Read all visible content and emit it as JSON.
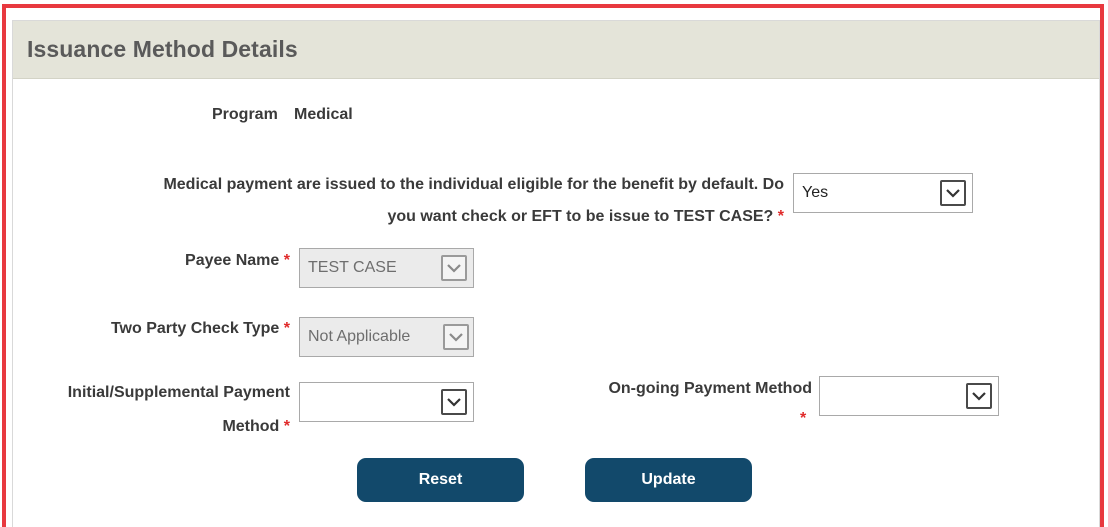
{
  "panel": {
    "title": "Issuance Method Details"
  },
  "program": {
    "label": "Program",
    "value": "Medical"
  },
  "question": {
    "line1": "Medical payment are issued to the individual eligible for the benefit by default. Do",
    "line2": "you want check or EFT to be issue to TEST CASE?",
    "required_mark": "*",
    "selected": "Yes"
  },
  "payee": {
    "label": "Payee Name",
    "required_mark": "*",
    "selected": "TEST CASE"
  },
  "two_party": {
    "label": "Two Party Check Type",
    "required_mark": "*",
    "selected": "Not Applicable"
  },
  "initial_payment": {
    "label_line1": "Initial/Supplemental Payment",
    "label_line2": "Method",
    "required_mark": "*",
    "selected": ""
  },
  "ongoing_payment": {
    "label": "On-going Payment Method",
    "required_mark": "*",
    "selected": ""
  },
  "buttons": {
    "reset": "Reset",
    "update": "Update"
  },
  "colors": {
    "accent_red": "#e8393f",
    "button_blue": "#12496b",
    "header_bg": "#e4e4d9"
  }
}
